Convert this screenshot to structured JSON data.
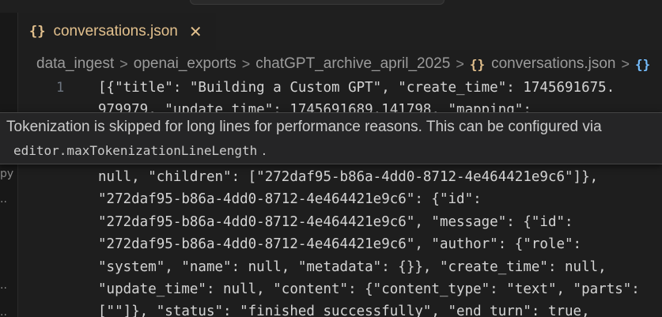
{
  "tab": {
    "icon": "{}",
    "icon_name": "json-braces-icon",
    "label": "conversations.json",
    "close": "✕",
    "accent_color": "#e2c08d"
  },
  "breadcrumb": {
    "items": [
      "data_ingest",
      "openai_exports",
      "chatGPT_archive_april_2025",
      "conversations.json"
    ],
    "separator": ">",
    "file_icon": "{}",
    "symbol_icon": "{}",
    "symbol_icon_color": "#75beff"
  },
  "sidebar": {
    "fragments": [
      "py",
      "..",
      "..",
      ".."
    ]
  },
  "editor": {
    "line_number": "1",
    "lines": [
      "[{\"title\": \"Building a Custom GPT\", \"create_time\": 1745691675.",
      "979979, \"update_time\": 1745691689.141798, \"mapping\":",
      "",
      "",
      "null, \"children\": [\"272daf95-b86a-4dd0-8712-4e464421e9c6\"]},",
      "\"272daf95-b86a-4dd0-8712-4e464421e9c6\": {\"id\":",
      "\"272daf95-b86a-4dd0-8712-4e464421e9c6\", \"message\": {\"id\":",
      "\"272daf95-b86a-4dd0-8712-4e464421e9c6\", \"author\": {\"role\":",
      "\"system\", \"name\": null, \"metadata\": {}}, \"create_time\": null,",
      "\"update_time\": null, \"content\": {\"content_type\": \"text\", \"parts\":",
      "[\"\"]}, \"status\": \"finished_successfully\", \"end_turn\": true,"
    ]
  },
  "tooltip": {
    "message": "Tokenization is skipped for long lines for performance reasons. This can be configured via",
    "setting": "editor.maxTokenizationLineLength",
    "period": "."
  }
}
